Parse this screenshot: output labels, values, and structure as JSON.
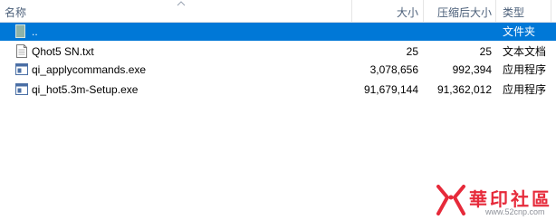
{
  "columns": {
    "name": "名称",
    "size": "大小",
    "compressed": "压缩后大小",
    "type": "类型"
  },
  "files": [
    {
      "icon": "folder-up-icon",
      "name": "..",
      "size": "",
      "compressed": "",
      "type": "文件夹",
      "selected": true
    },
    {
      "icon": "text-file-icon",
      "name": "Qhot5 SN.txt",
      "size": "25",
      "compressed": "25",
      "type": "文本文档",
      "selected": false
    },
    {
      "icon": "exe-file-icon",
      "name": "qi_applycommands.exe",
      "size": "3,078,656",
      "compressed": "992,394",
      "type": "应用程序",
      "selected": false
    },
    {
      "icon": "exe-file-icon",
      "name": "qi_hot5.3m-Setup.exe",
      "size": "91,679,144",
      "compressed": "91,362,012",
      "type": "应用程序",
      "selected": false
    }
  ],
  "watermark": {
    "brand": "華印社區",
    "url": "www.52cnp.com",
    "brand_color": "#e62a3a"
  },
  "colors": {
    "selection": "#0078d7",
    "header_text": "#4c607a",
    "grid_line": "#e5e5e5"
  }
}
